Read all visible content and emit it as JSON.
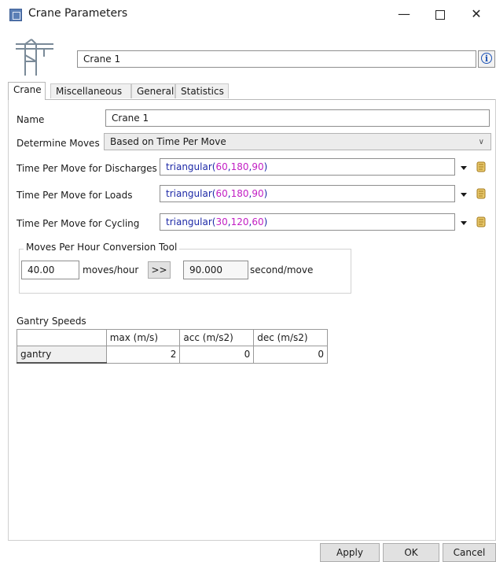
{
  "window": {
    "title": "Crane Parameters",
    "minimize_glyph": "—",
    "close_glyph": "✕"
  },
  "header": {
    "object_name": "Crane 1",
    "info_glyph": "i"
  },
  "tabs": [
    {
      "label": "Crane",
      "active": true
    },
    {
      "label": "Miscellaneous",
      "active": false
    },
    {
      "label": "General",
      "active": false
    },
    {
      "label": "Statistics",
      "active": false
    }
  ],
  "form": {
    "name_label": "Name",
    "name_value": "Crane 1",
    "determine_moves_label": "Determine Moves",
    "determine_moves_value": "Based on Time Per Move",
    "discharges_label": "Time Per Move for Discharges",
    "discharges_expr": {
      "fn": "triangular",
      "args": [
        "60",
        "180",
        "90"
      ]
    },
    "loads_label": "Time Per Move for Loads",
    "loads_expr": {
      "fn": "triangular",
      "args": [
        "60",
        "180",
        "90"
      ]
    },
    "cycling_label": "Time Per Move for Cycling",
    "cycling_expr": {
      "fn": "triangular",
      "args": [
        "30",
        "120",
        "60"
      ]
    }
  },
  "conversion_tool": {
    "title": "Moves Per Hour Conversion Tool",
    "moves_value": "40.00",
    "moves_unit": "moves/hour",
    "convert_button": ">>",
    "seconds_value": "90.000",
    "seconds_unit": "second/move"
  },
  "gantry": {
    "section_label": "Gantry Speeds",
    "columns": [
      "max (m/s)",
      "acc (m/s2)",
      "dec (m/s2)"
    ],
    "rows": [
      {
        "name": "gantry",
        "values": [
          "2",
          "0",
          "0"
        ]
      }
    ]
  },
  "footer": {
    "apply": "Apply",
    "ok": "OK",
    "cancel": "Cancel"
  },
  "colors": {
    "function_text": "#1e2aa7",
    "number_text": "#c21fc4",
    "info_icon": "#1c52b5"
  }
}
